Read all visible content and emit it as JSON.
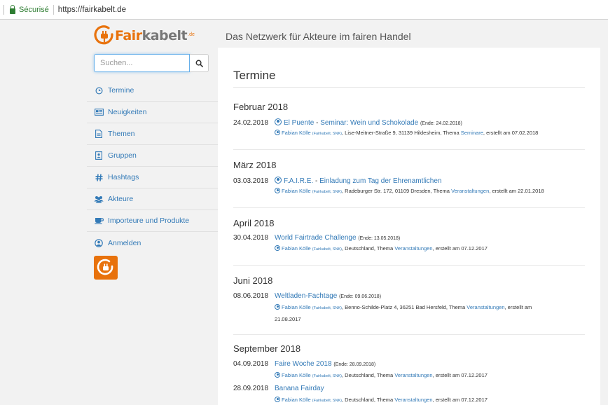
{
  "browser": {
    "secure_label": "Sécurisé",
    "url": "https://fairkabelt.de"
  },
  "logo": {
    "word_a": "Fair",
    "word_b": "kabelt",
    "suffix": ".de"
  },
  "header": {
    "tagline": "Das Netzwerk für Akteure im fairen Handel"
  },
  "search": {
    "placeholder": "Suchen..."
  },
  "sidebar": {
    "items": [
      {
        "label": "Termine",
        "icon": "clock-icon"
      },
      {
        "label": "Neuigkeiten",
        "icon": "newspaper-icon"
      },
      {
        "label": "Themen",
        "icon": "document-icon"
      },
      {
        "label": "Gruppen",
        "icon": "group-icon"
      },
      {
        "label": "Hashtags",
        "icon": "hashtag-icon"
      },
      {
        "label": "Akteure",
        "icon": "users-icon"
      },
      {
        "label": "Importeure und Produkte",
        "icon": "cup-icon"
      },
      {
        "label": "Anmelden",
        "icon": "user-circle-icon"
      }
    ]
  },
  "main": {
    "title": "Termine",
    "months": [
      {
        "name": "Februar 2018",
        "events": [
          {
            "date": "24.02.2018",
            "title_a": "El Puente",
            "dash": " - ",
            "title_b": "Seminar: Wein und Schokolade",
            "end": "(Ende: 24.02.2018)",
            "author": "Fabian Kölle",
            "org": "(Fairkabelt, SNK)",
            "place": ", Lise-Meitner-Straße 9, 31139 Hildesheim, Thema ",
            "topic": "Seminare",
            "created": ", erstellt am 07.02.2018",
            "created2": ""
          }
        ]
      },
      {
        "name": "März 2018",
        "events": [
          {
            "date": "03.03.2018",
            "title_a": "F.A.I.R.E.",
            "dash": " - ",
            "title_b": "Einladung zum Tag der Ehrenamtlichen",
            "end": "",
            "author": "Fabian Kölle",
            "org": "(Fairkabelt, SNK)",
            "place": ", Radeburger Str. 172, 01109 Dresden, Thema ",
            "topic": "Veranstaltungen",
            "created": ", erstellt am 22.01.2018",
            "created2": ""
          }
        ]
      },
      {
        "name": "April 2018",
        "events": [
          {
            "date": "30.04.2018",
            "title_a": "World Fairtrade Challenge",
            "dash": "",
            "title_b": "",
            "end": "(Ende: 13.05.2018)",
            "author": "Fabian Kölle",
            "org": "(Fairkabelt, SNK)",
            "place": ", Deutschland, Thema ",
            "topic": "Veranstaltungen",
            "created": ", erstellt am 07.12.2017",
            "created2": ""
          }
        ]
      },
      {
        "name": "Juni 2018",
        "events": [
          {
            "date": "08.06.2018",
            "title_a": "Weltladen-Fachtage",
            "dash": "",
            "title_b": "",
            "end": "(Ende: 09.06.2018)",
            "author": "Fabian Kölle",
            "org": "(Fairkabelt, SNK)",
            "place": ", Benno-Schilde-Platz 4, 36251 Bad Hersfeld, Thema ",
            "topic": "Veranstaltungen",
            "created": ", erstellt am",
            "created2": "21.08.2017"
          }
        ]
      },
      {
        "name": "September 2018",
        "events": [
          {
            "date": "04.09.2018",
            "title_a": "Faire Woche 2018",
            "dash": "",
            "title_b": "",
            "end": "(Ende: 28.09.2018)",
            "author": "Fabian Kölle",
            "org": "(Fairkabelt, SNK)",
            "place": ", Deutschland, Thema ",
            "topic": "Veranstaltungen",
            "created": ", erstellt am 07.12.2017",
            "created2": ""
          },
          {
            "date": "28.09.2018",
            "title_a": "Banana Fairday",
            "dash": "",
            "title_b": "",
            "end": "",
            "author": "Fabian Kölle",
            "org": "(Fairkabelt, SNK)",
            "place": ", Deutschland, Thema ",
            "topic": "Veranstaltungen",
            "created": ", erstellt am 07.12.2017",
            "created2": ""
          }
        ]
      }
    ]
  },
  "colors": {
    "brand": "#e8720c",
    "link": "#337ab7",
    "secure": "#2e7d32"
  }
}
